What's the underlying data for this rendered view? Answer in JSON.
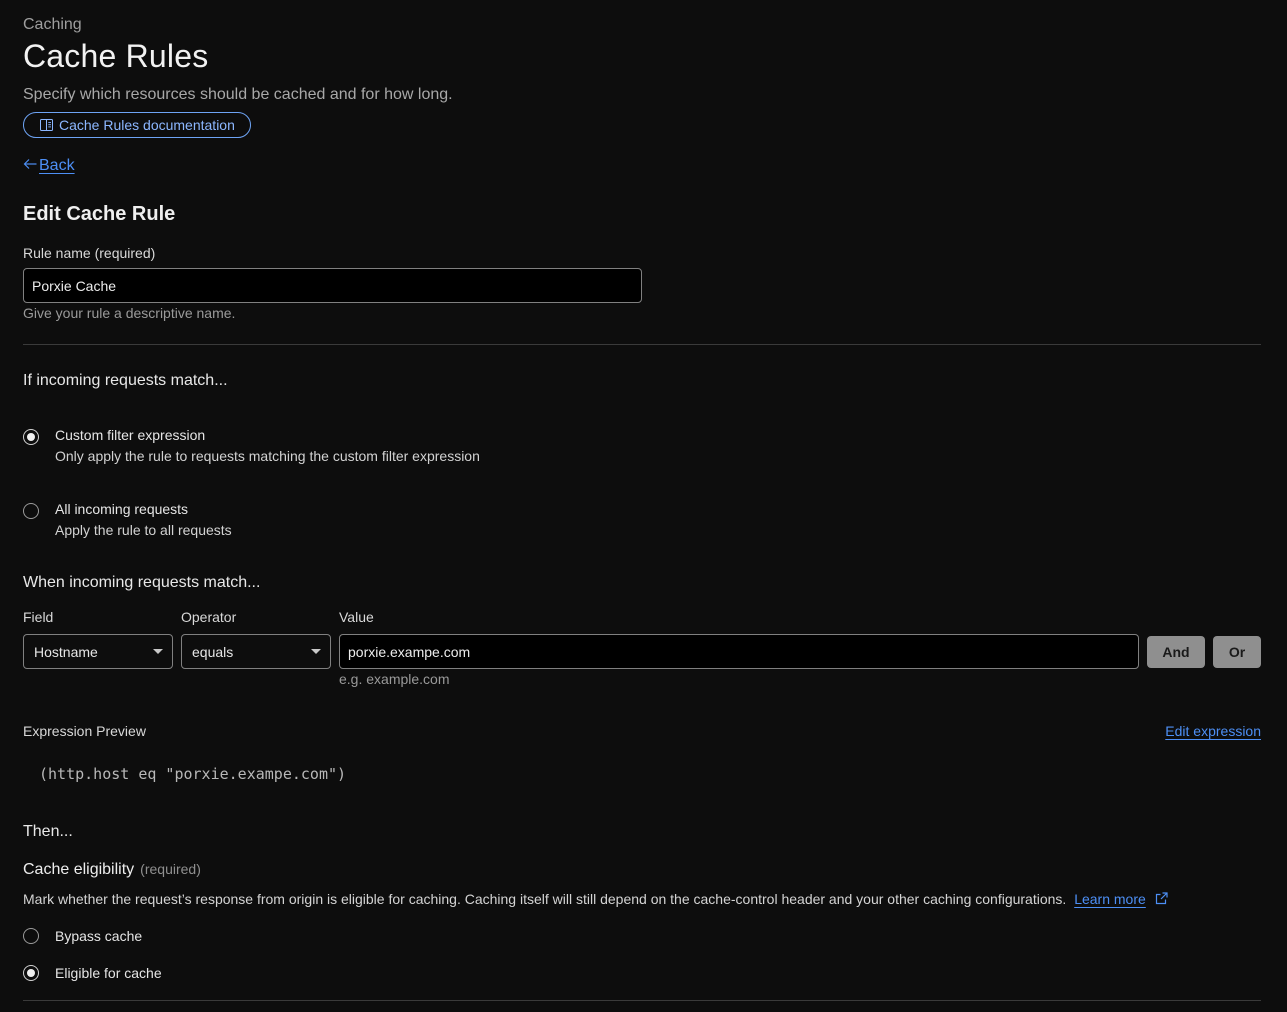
{
  "header": {
    "section": "Caching",
    "title": "Cache Rules",
    "description": "Specify which resources should be cached and for how long.",
    "doc_link": "Cache Rules documentation",
    "back": "Back"
  },
  "form": {
    "title": "Edit Cache Rule",
    "rule_name": {
      "label": "Rule name (required)",
      "value": "Porxie Cache",
      "hint": "Give your rule a descriptive name."
    }
  },
  "match": {
    "heading": "If incoming requests match...",
    "options": [
      {
        "title": "Custom filter expression",
        "subtitle": "Only apply the rule to requests matching the custom filter expression",
        "selected": true
      },
      {
        "title": "All incoming requests",
        "subtitle": "Apply the rule to all requests",
        "selected": false
      }
    ]
  },
  "filter": {
    "heading": "When incoming requests match...",
    "field_label": "Field",
    "operator_label": "Operator",
    "value_label": "Value",
    "field_value": "Hostname",
    "operator_value": "equals",
    "value_value": "porxie.exampe.com",
    "value_hint": "e.g. example.com",
    "and_label": "And",
    "or_label": "Or"
  },
  "expression": {
    "label": "Expression Preview",
    "edit_label": "Edit expression",
    "code": "(http.host eq \"porxie.exampe.com\")"
  },
  "then": {
    "heading": "Then...",
    "eligibility_title": "Cache eligibility",
    "eligibility_required": "(required)",
    "eligibility_desc": "Mark whether the request’s response from origin is eligible for caching. Caching itself will still depend on the cache-control header and your other caching configurations.",
    "learn_more": "Learn more",
    "options": [
      {
        "label": "Bypass cache",
        "selected": false
      },
      {
        "label": "Eligible for cache",
        "selected": true
      }
    ]
  },
  "icons": {
    "doc": "book-icon",
    "back": "arrow-left-icon",
    "select_caret": "caret-down-icon",
    "external": "external-link-icon"
  },
  "colors": {
    "background": "#0d0d0d",
    "link": "#4d8ff5",
    "pill_border": "#6ea4f5",
    "button_gray": "#8f8f8f"
  }
}
